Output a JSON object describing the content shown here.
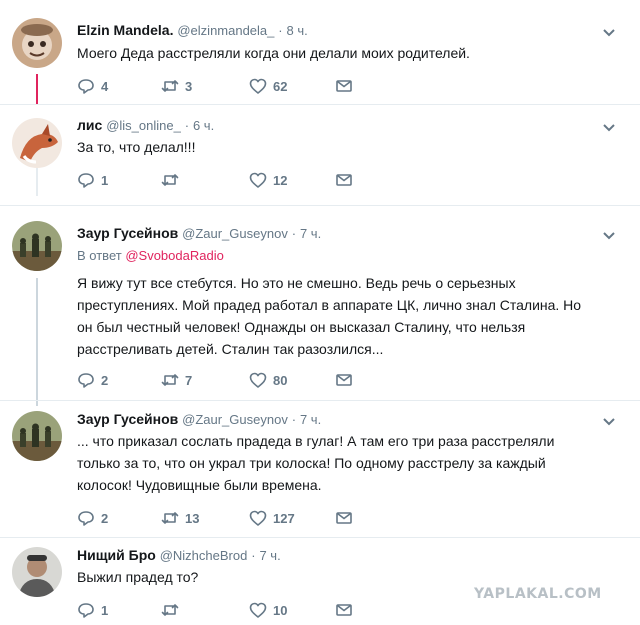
{
  "tweets": [
    {
      "name": "Elzin Mandela.",
      "handle": "@elzinmandela_",
      "sep": "·",
      "time": "8 ч.",
      "reply_prefix": "",
      "reply_link": "",
      "lines": [
        "Моего Деда расстреляли когда они делали моих родителей."
      ],
      "replies": "4",
      "retweets": "3",
      "likes": "62"
    },
    {
      "name": "лис",
      "handle": "@lis_online_",
      "sep": "·",
      "time": "6 ч.",
      "reply_prefix": "",
      "reply_link": "",
      "lines": [
        "За то, что делал!!!"
      ],
      "replies": "1",
      "retweets": "",
      "likes": "12"
    },
    {
      "name": "Заур Гусейнов",
      "handle": "@Zaur_Guseynov",
      "sep": "·",
      "time": "7 ч.",
      "reply_prefix": "В ответ",
      "reply_link": "@SvobodaRadio",
      "lines": [
        "Я вижу тут все стебутся. Но это не смешно. Ведь речь о серьезных",
        "преступлениях. Мой прадед работал в аппарате ЦК, лично знал Сталина. Но",
        "он был честный человек! Однажды он высказал Сталину, что нельзя",
        "расстреливать детей. Сталин так разозлился..."
      ],
      "replies": "2",
      "retweets": "7",
      "likes": "80"
    },
    {
      "name": "Заур Гусейнов",
      "handle": "@Zaur_Guseynov",
      "sep": "·",
      "time": "7 ч.",
      "reply_prefix": "",
      "reply_link": "",
      "lines": [
        "... что приказал сослать прадеда в гулаг! А там его три раза расстреляли",
        "только за то, что он украл три колоска! По одному расстрелу за каждый",
        "колосок! Чудовищные были времена."
      ],
      "replies": "2",
      "retweets": "13",
      "likes": "127"
    },
    {
      "name": "Нищий Бро",
      "handle": "@NizhcheBrod",
      "sep": "·",
      "time": "7 ч.",
      "reply_prefix": "",
      "reply_link": "",
      "lines": [
        "Выжил прадед то?"
      ],
      "replies": "1",
      "retweets": "",
      "likes": "10"
    }
  ],
  "watermark": "YAPLAKAL.COM",
  "colors": {
    "thread_line": "#e0245e",
    "text": "#14171a",
    "muted": "#657786",
    "reply_link": "#e0245e"
  },
  "icons": {
    "reply": "reply-icon",
    "retweet": "retweet-icon",
    "like": "like-icon",
    "dm": "direct-message-icon",
    "more": "chevron-down-icon"
  }
}
